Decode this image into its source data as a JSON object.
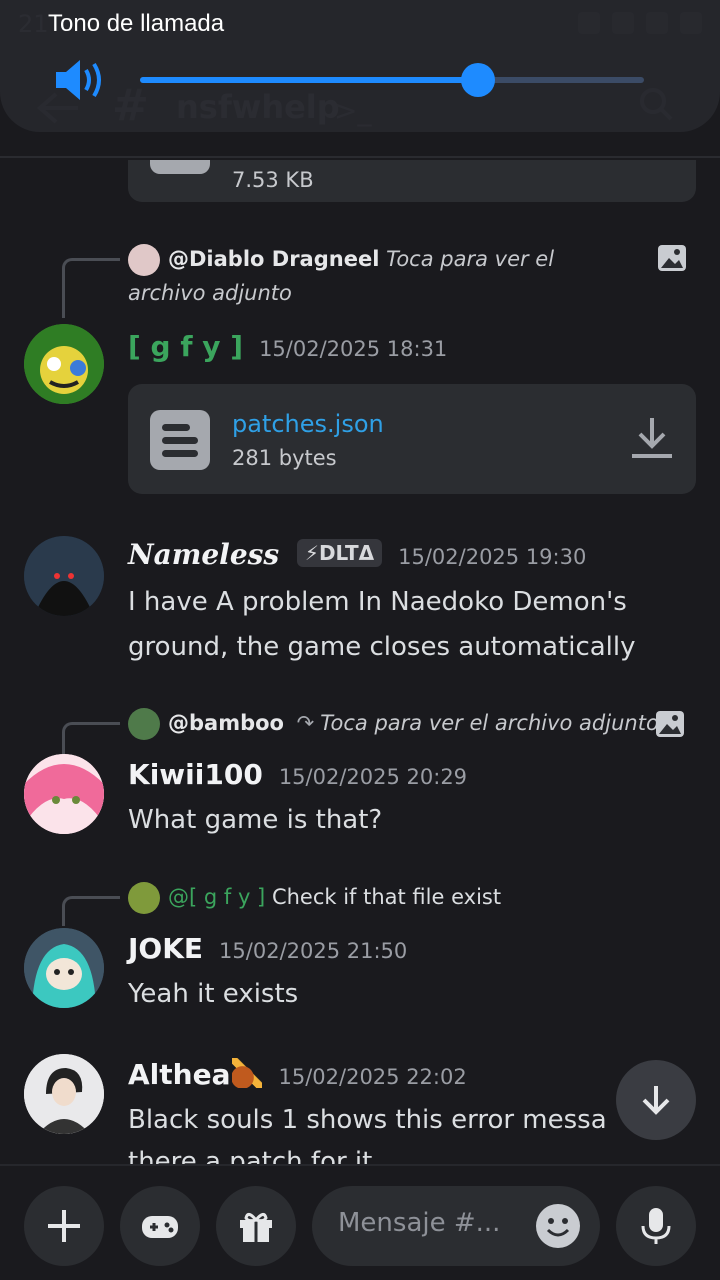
{
  "status": {
    "time": "21"
  },
  "volume": {
    "label": "Tono de llamada",
    "level": 0.67
  },
  "header": {
    "hash": "#",
    "channel": "nsfwhelp",
    "channel_suffix": ">_"
  },
  "top_attachment": {
    "size": "7.53 KB"
  },
  "messages": [
    {
      "reply": {
        "name": "@Diablo Dragneel",
        "text": "Toca para ver el archivo adjunto"
      },
      "author": "[ g f y ]",
      "timestamp": "15/02/2025 18:31",
      "attachment": {
        "name": "patches.json",
        "size": "281 bytes"
      }
    },
    {
      "author": "Nameless",
      "badge": "⚡DLTΔ",
      "timestamp": "15/02/2025 19:30",
      "text": "I have A problem In Naedoko Demon's ground, the game closes automatically"
    },
    {
      "reply": {
        "name": "@bamboo",
        "text": "Toca para ver el archivo adjunto"
      },
      "author": "Kiwii100",
      "timestamp": "15/02/2025 20:29",
      "text": "What game is that?"
    },
    {
      "reply": {
        "name": "@[ g f y ]",
        "text": "Check if that file exist"
      },
      "author": "JOKE",
      "timestamp": "15/02/2025 21:50",
      "text": "Yeah it exists"
    },
    {
      "author": "Althea",
      "timestamp": "15/02/2025 22:02",
      "text": "Black souls 1 shows this error messa",
      "text2": "there a patch for it"
    }
  ],
  "composer": {
    "placeholder": "Mensaje #..."
  },
  "colors": {
    "accent": "#1e8bff",
    "link": "#2fa0e6",
    "gfy_green": "#3ba55d"
  }
}
